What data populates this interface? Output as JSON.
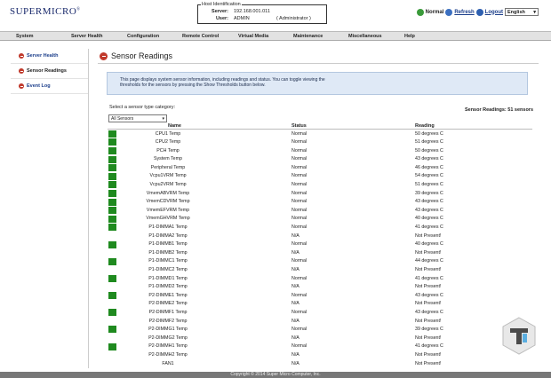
{
  "header": {
    "logo": "SUPERMICRO",
    "logo_mark": "®",
    "host": {
      "legend": "Host Identification",
      "server_label": "Server:",
      "server_value": "192.168.001.011",
      "user_label": "User:",
      "user_value": "ADMIN",
      "user_role": "( Administrator )"
    },
    "status_label": "Normal",
    "refresh_label": "Refresh",
    "logout_label": "Logout",
    "language": "English"
  },
  "nav": [
    "System",
    "Server Health",
    "Configuration",
    "Remote Control",
    "Virtual Media",
    "Maintenance",
    "Miscellaneous",
    "Help"
  ],
  "sidebar": [
    {
      "label": "Server Health"
    },
    {
      "label": "Sensor Readings"
    },
    {
      "label": "Event Log"
    }
  ],
  "main": {
    "title": "Sensor Readings",
    "info_line1": "This page displays system sensor information, including readings and status. You can toggle viewing the",
    "info_line2": "thresholds for the sensors by pressing the Show Thresholds button below.",
    "category_label": "Select a sensor type category:",
    "category_value": "All Sensors",
    "count_text": "Sensor Readings: 51 sensors",
    "columns": {
      "name": "Name",
      "status": "Status",
      "reading": "Reading",
      "sort": "↕"
    },
    "rows": [
      {
        "name": "CPU1 Temp",
        "status": "Normal",
        "reading": "50 degrees C",
        "ok": true
      },
      {
        "name": "CPU2 Temp",
        "status": "Normal",
        "reading": "51 degrees C",
        "ok": true
      },
      {
        "name": "PCH Temp",
        "status": "Normal",
        "reading": "50 degrees C",
        "ok": true
      },
      {
        "name": "System Temp",
        "status": "Normal",
        "reading": "43 degrees C",
        "ok": true
      },
      {
        "name": "Peripheral Temp",
        "status": "Normal",
        "reading": "46 degrees C",
        "ok": true
      },
      {
        "name": "Vcpu1VRM Temp",
        "status": "Normal",
        "reading": "54 degrees C",
        "ok": true
      },
      {
        "name": "Vcpu2VRM Temp",
        "status": "Normal",
        "reading": "51 degrees C",
        "ok": true
      },
      {
        "name": "VmemABVRM Temp",
        "status": "Normal",
        "reading": "39 degrees C",
        "ok": true
      },
      {
        "name": "VmemCDVRM Temp",
        "status": "Normal",
        "reading": "43 degrees C",
        "ok": true
      },
      {
        "name": "VmemEFVRM Temp",
        "status": "Normal",
        "reading": "43 degrees C",
        "ok": true
      },
      {
        "name": "VmemGHVRM Temp",
        "status": "Normal",
        "reading": "40 degrees C",
        "ok": true
      },
      {
        "name": "P1-DIMMA1 Temp",
        "status": "Normal",
        "reading": "41 degrees C",
        "ok": true
      },
      {
        "name": "P1-DIMMA2 Temp",
        "status": "N/A",
        "reading": "Not Present!",
        "ok": false
      },
      {
        "name": "P1-DIMMB1 Temp",
        "status": "Normal",
        "reading": "40 degrees C",
        "ok": true
      },
      {
        "name": "P1-DIMMB2 Temp",
        "status": "N/A",
        "reading": "Not Present!",
        "ok": false
      },
      {
        "name": "P1-DIMMC1 Temp",
        "status": "Normal",
        "reading": "44 degrees C",
        "ok": true
      },
      {
        "name": "P1-DIMMC2 Temp",
        "status": "N/A",
        "reading": "Not Present!",
        "ok": false
      },
      {
        "name": "P1-DIMMD1 Temp",
        "status": "Normal",
        "reading": "41 degrees C",
        "ok": true
      },
      {
        "name": "P1-DIMMD2 Temp",
        "status": "N/A",
        "reading": "Not Present!",
        "ok": false
      },
      {
        "name": "P2-DIMME1 Temp",
        "status": "Normal",
        "reading": "43 degrees C",
        "ok": true
      },
      {
        "name": "P2-DIMME2 Temp",
        "status": "N/A",
        "reading": "Not Present!",
        "ok": false
      },
      {
        "name": "P2-DIMMF1 Temp",
        "status": "Normal",
        "reading": "43 degrees C",
        "ok": true
      },
      {
        "name": "P2-DIMMF2 Temp",
        "status": "N/A",
        "reading": "Not Present!",
        "ok": false
      },
      {
        "name": "P2-DIMMG1 Temp",
        "status": "Normal",
        "reading": "39 degrees C",
        "ok": true
      },
      {
        "name": "P2-DIMMG2 Temp",
        "status": "N/A",
        "reading": "Not Present!",
        "ok": false
      },
      {
        "name": "P2-DIMMH1 Temp",
        "status": "Normal",
        "reading": "41 degrees C",
        "ok": true
      },
      {
        "name": "P2-DIMMH2 Temp",
        "status": "N/A",
        "reading": "Not Present!",
        "ok": false
      },
      {
        "name": "FAN1",
        "status": "N/A",
        "reading": "Not Present!",
        "ok": false
      }
    ]
  },
  "footer": "Copyright © 2014 Super Micro Computer, Inc.",
  "colors": {
    "status_ok": "#1f8a1f",
    "accent": "#c0392b",
    "link": "#1a3d8a"
  },
  "icons": {
    "status": "green-check-icon",
    "refresh": "refresh-icon",
    "logout": "logout-icon",
    "nav_dot": "red-arrow-icon"
  }
}
